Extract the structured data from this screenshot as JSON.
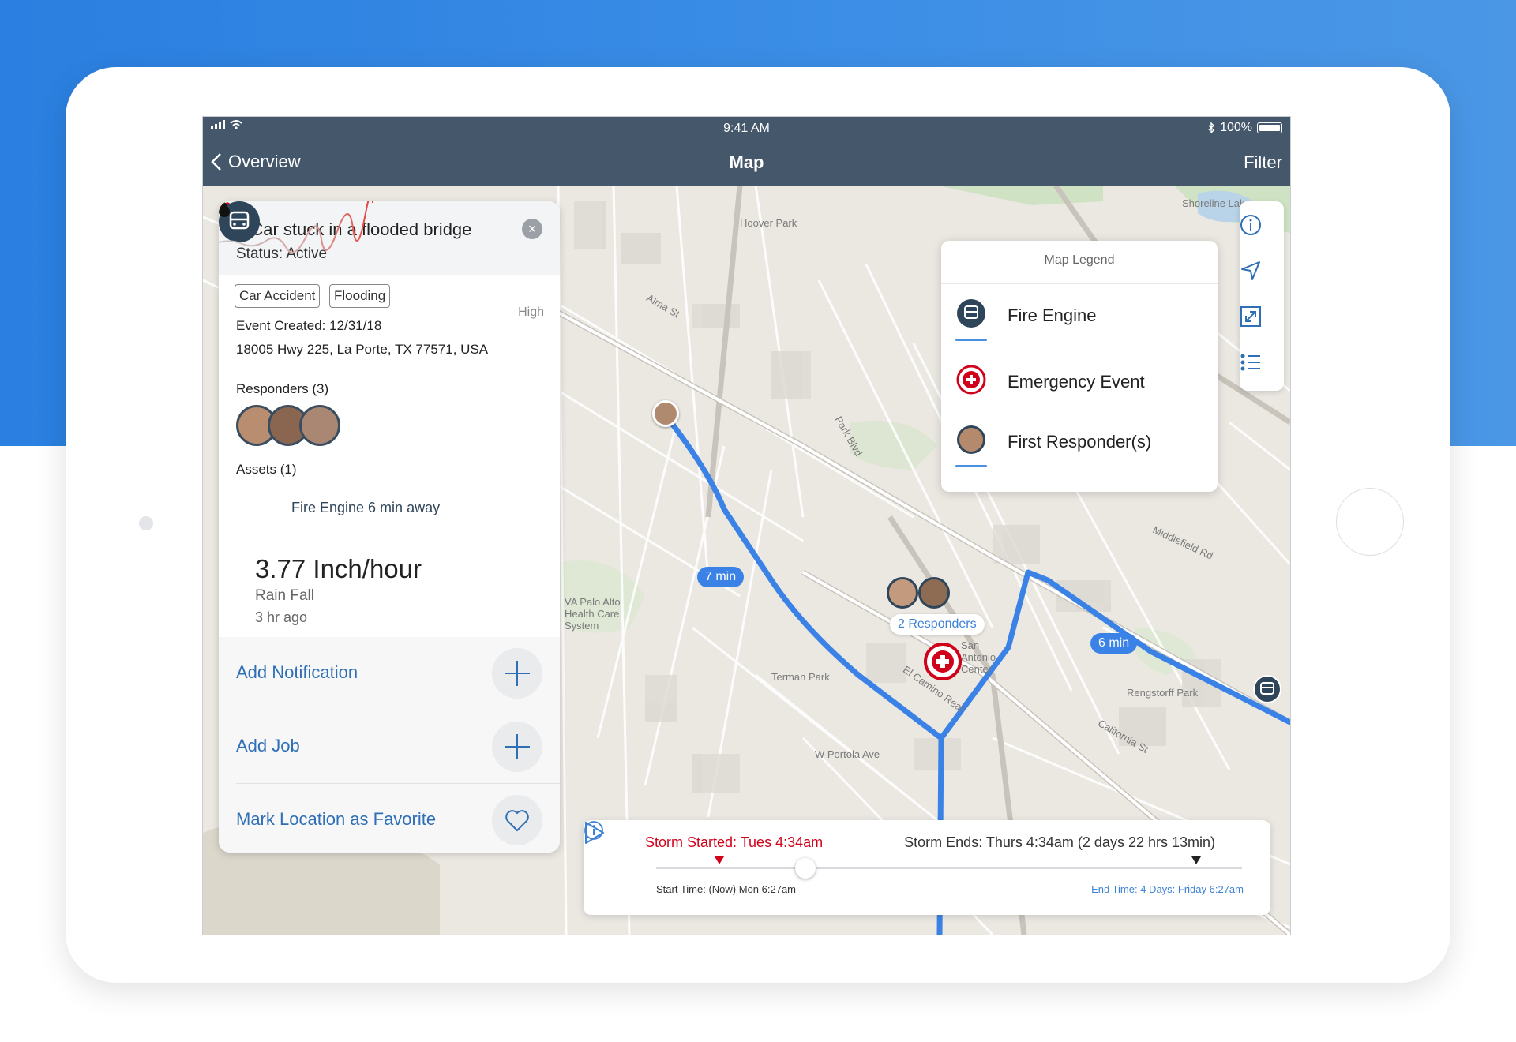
{
  "status_bar": {
    "time": "9:41 AM",
    "battery": "100%"
  },
  "nav": {
    "back_label": "Overview",
    "title": "Map",
    "filter_label": "Filter"
  },
  "event": {
    "title": "1 Car stuck in a flooded bridge",
    "status": "Status: Active",
    "tags": [
      "Car Accident",
      "Flooding"
    ],
    "priority": "High",
    "created": "Event Created: 12/31/18",
    "address": "18005 Hwy 225, La Porte, TX 77571, USA",
    "responders_label": "Responders (3)",
    "assets_label": "Assets (1)",
    "asset_text": "Fire Engine 6 min away",
    "rain_value": "3.77 Inch/hour",
    "rain_label": "Rain Fall",
    "rain_ago": "3 hr ago"
  },
  "actions": [
    {
      "label": "Add Notification",
      "icon": "plus-icon"
    },
    {
      "label": "Add Job",
      "icon": "plus-icon"
    },
    {
      "label": "Mark Location as Favorite",
      "icon": "heart-icon"
    }
  ],
  "legend": {
    "title": "Map Legend",
    "items": [
      {
        "label": "Fire Engine",
        "icon": "fire-engine-icon"
      },
      {
        "label": "Emergency Event",
        "icon": "emergency-event-icon"
      },
      {
        "label": "First Responder(s)",
        "icon": "first-responder-icon"
      }
    ]
  },
  "map": {
    "route_labels": [
      "7 min",
      "6 min"
    ],
    "responders_badge": "2 Responders",
    "place_labels": [
      "Hoover Park",
      "VA Palo Alto Health Care System",
      "Terman Park",
      "San Antonio Center",
      "Rengstorff Park",
      "W Portola Ave",
      "Shoreline Lake",
      "Alma St",
      "Middlefield Rd",
      "Park Blvd",
      "El Camino Real",
      "California St"
    ]
  },
  "timeline": {
    "storm_started": "Storm Started: Tues 4:34am",
    "storm_ends": "Storm Ends: Thurs 4:34am (2 days 22 hrs 13min)",
    "start_time": "Start Time: (Now) Mon 6:27am",
    "end_time": "End Time: 4 Days: Friday 6:27am"
  },
  "colors": {
    "nav": "#45586b",
    "route": "#3b82e6",
    "emergency": "#d0021b",
    "link": "#2f6fb5"
  }
}
